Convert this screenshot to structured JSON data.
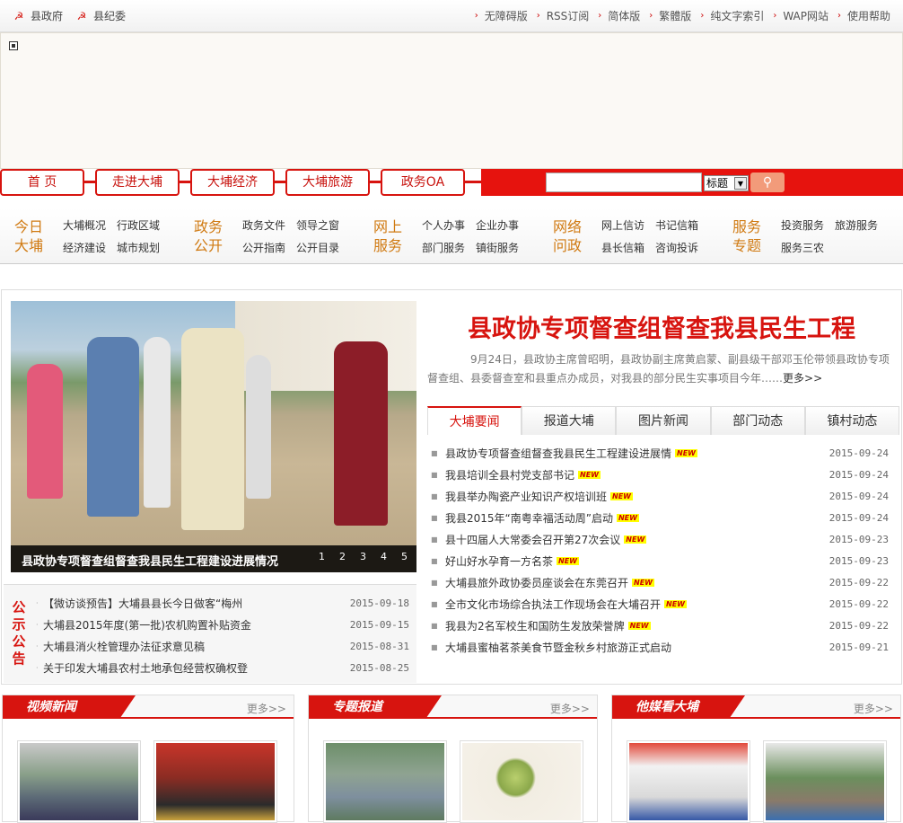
{
  "topbar": {
    "left": [
      "县政府",
      "县纪委"
    ],
    "right": [
      "无障碍版",
      "RSS订阅",
      "简体版",
      "繁體版",
      "纯文字索引",
      "WAP网站",
      "使用帮助"
    ]
  },
  "nav": {
    "items": [
      "首 页",
      "走进大埔",
      "大埔经济",
      "大埔旅游",
      "政务OA"
    ],
    "search_placeholder": "",
    "search_select": "标题",
    "search_icon": "magnifier-icon"
  },
  "quick": [
    {
      "title": "今日大埔",
      "links": [
        "大埔概况",
        "行政区域",
        "经济建设",
        "城市规划"
      ]
    },
    {
      "title": "政务公开",
      "links": [
        "政务文件",
        "领导之窗",
        "公开指南",
        "公开目录"
      ]
    },
    {
      "title": "网上服务",
      "links": [
        "个人办事",
        "企业办事",
        "部门服务",
        "镇街服务"
      ]
    },
    {
      "title": "网络问政",
      "links": [
        "网上信访",
        "书记信箱",
        "县长信箱",
        "咨询投诉"
      ]
    },
    {
      "title": "服务专题",
      "links": [
        "投资服务",
        "旅游服务",
        "服务三农"
      ]
    }
  ],
  "headline": {
    "photo_caption": "县政协专项督查组督查我县民生工程建设进展情况",
    "pages": [
      "1",
      "2",
      "3",
      "4",
      "5"
    ],
    "title": "县政协专项督查组督查我县民生工程",
    "summary": "9月24日，县政协主席曾昭明，县政协副主席黄启蒙、副县级干部邓玉伦带领县政协专项督查组、县委督查室和县重点办成员，对我县的部分民生实事项目今年……",
    "more": "更多>>"
  },
  "tabs": [
    "大埔要闻",
    "报道大埔",
    "图片新闻",
    "部门动态",
    "镇村动态"
  ],
  "news_badge": "NEW",
  "news": [
    {
      "title": "县政协专项督查组督查我县民生工程建设进展情",
      "date": "2015-09-24",
      "new": true
    },
    {
      "title": "我县培训全县村党支部书记",
      "date": "2015-09-24",
      "new": true
    },
    {
      "title": "我县举办陶瓷产业知识产权培训班",
      "date": "2015-09-24",
      "new": true
    },
    {
      "title": "我县2015年“南粤幸福活动周”启动",
      "date": "2015-09-24",
      "new": true
    },
    {
      "title": "县十四届人大常委会召开第27次会议",
      "date": "2015-09-23",
      "new": true
    },
    {
      "title": "好山好水孕育一方名茶",
      "date": "2015-09-23",
      "new": true
    },
    {
      "title": "大埔县旅外政协委员座谈会在东莞召开",
      "date": "2015-09-22",
      "new": true
    },
    {
      "title": "全市文化市场综合执法工作现场会在大埔召开",
      "date": "2015-09-22",
      "new": true
    },
    {
      "title": "我县为2名军校生和国防生发放荣誉牌",
      "date": "2015-09-22",
      "new": true
    },
    {
      "title": "大埔县蜜柚茗茶美食节暨金秋乡村旅游正式启动",
      "date": "2015-09-21",
      "new": false
    }
  ],
  "notice": {
    "label": "公示公告",
    "items": [
      {
        "title": "【微访谈预告】大埔县县长今日做客“梅州",
        "date": "2015-09-18"
      },
      {
        "title": "大埔县2015年度(第一批)农机购置补贴资金",
        "date": "2015-09-15"
      },
      {
        "title": "大埔县消火栓管理办法征求意见稿",
        "date": "2015-08-31"
      },
      {
        "title": "关于印发大埔县农村土地承包经营权确权登",
        "date": "2015-08-25"
      }
    ]
  },
  "sections": [
    {
      "title": "视频新闻",
      "more": "更多>>"
    },
    {
      "title": "专题报道",
      "more": "更多>>"
    },
    {
      "title": "他媒看大埔",
      "more": "更多>>"
    }
  ]
}
